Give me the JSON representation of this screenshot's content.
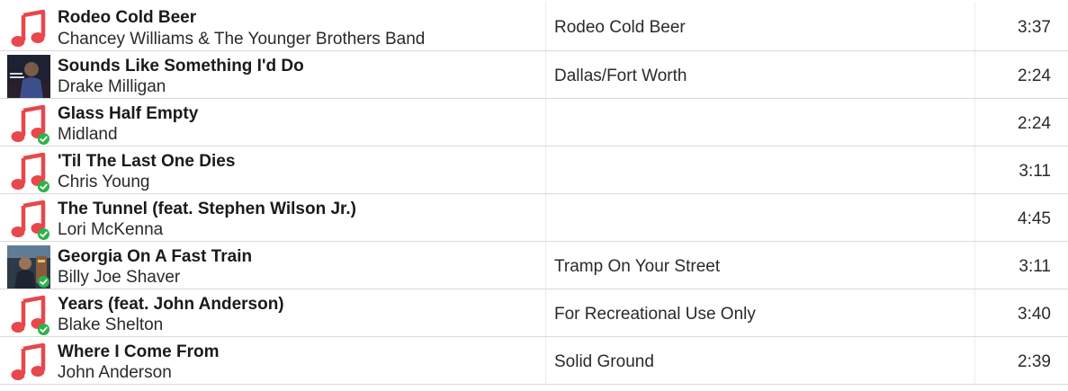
{
  "colors": {
    "note_icon": "#e8474b",
    "check_badge": "#2db24a",
    "row_divider": "#d9d9d9",
    "title_text": "#1a1a1a",
    "secondary_text": "#2a2a2a"
  },
  "tracks": [
    {
      "title": "Rodeo Cold Beer",
      "artist": "Chancey Williams & The Younger Brothers Band",
      "album": "Rodeo Cold Beer",
      "duration": "3:37",
      "art": "music-note-icon",
      "downloaded": false
    },
    {
      "title": "Sounds Like Something I'd Do",
      "artist": "Drake Milligan",
      "album": "Dallas/Fort Worth",
      "duration": "2:24",
      "art": "album-cover",
      "downloaded": false
    },
    {
      "title": "Glass Half Empty",
      "artist": "Midland",
      "album": "",
      "duration": "2:24",
      "art": "music-note-icon",
      "downloaded": true
    },
    {
      "title": "'Til The Last One Dies",
      "artist": "Chris Young",
      "album": "",
      "duration": "3:11",
      "art": "music-note-icon",
      "downloaded": true
    },
    {
      "title": "The Tunnel (feat. Stephen Wilson Jr.)",
      "artist": "Lori McKenna",
      "album": "",
      "duration": "4:45",
      "art": "music-note-icon",
      "downloaded": true
    },
    {
      "title": "Georgia On A Fast Train",
      "artist": "Billy Joe Shaver",
      "album": "Tramp On Your Street",
      "duration": "3:11",
      "art": "album-cover",
      "downloaded": true
    },
    {
      "title": "Years (feat. John Anderson)",
      "artist": "Blake Shelton",
      "album": "For Recreational Use Only",
      "duration": "3:40",
      "art": "music-note-icon",
      "downloaded": true
    },
    {
      "title": "Where I Come From",
      "artist": "John Anderson",
      "album": "Solid Ground",
      "duration": "2:39",
      "art": "music-note-icon",
      "downloaded": false
    }
  ]
}
